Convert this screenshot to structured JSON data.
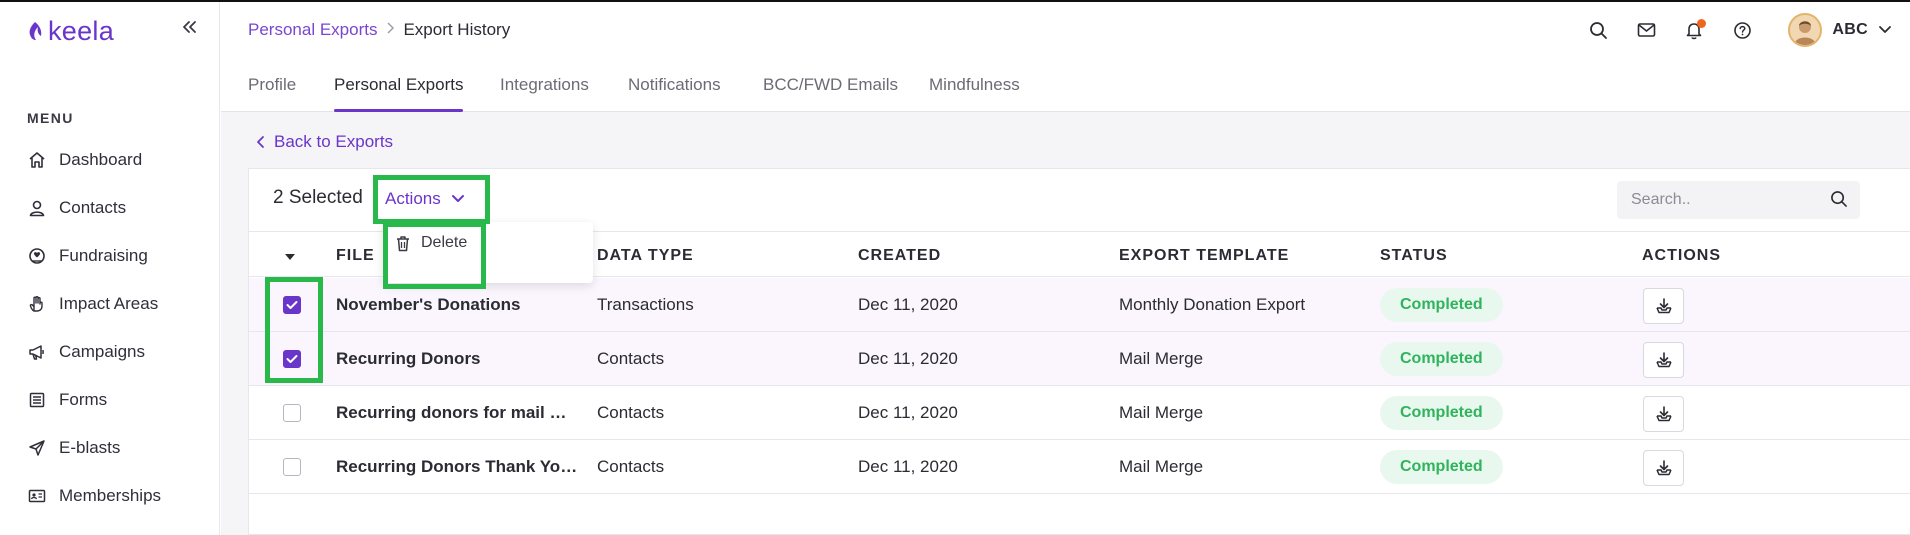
{
  "app": {
    "logo_text": "keela"
  },
  "sidebar": {
    "menu_title": "MENU",
    "items": [
      {
        "label": "Dashboard",
        "icon": "home-icon"
      },
      {
        "label": "Contacts",
        "icon": "user-icon"
      },
      {
        "label": "Fundraising",
        "icon": "donation-icon"
      },
      {
        "label": "Impact Areas",
        "icon": "hand-icon"
      },
      {
        "label": "Campaigns",
        "icon": "megaphone-icon"
      },
      {
        "label": "Forms",
        "icon": "form-icon"
      },
      {
        "label": "E-blasts",
        "icon": "send-icon"
      },
      {
        "label": "Memberships",
        "icon": "id-card-icon"
      }
    ]
  },
  "header": {
    "breadcrumb": {
      "parent": "Personal Exports",
      "current": "Export History"
    },
    "user_name": "ABC"
  },
  "tabs": [
    {
      "label": "Profile",
      "active": false
    },
    {
      "label": "Personal Exports",
      "active": true
    },
    {
      "label": "Integrations",
      "active": false
    },
    {
      "label": "Notifications",
      "active": false
    },
    {
      "label": "BCC/FWD Emails",
      "active": false
    },
    {
      "label": "Mindfulness",
      "active": false
    }
  ],
  "main": {
    "back_label": "Back to Exports",
    "selected_text": "2 Selected",
    "actions_label": "Actions",
    "dropdown": {
      "delete_label": "Delete"
    },
    "search_placeholder": "Search..",
    "columns": [
      "FILE",
      "DATA TYPE",
      "CREATED",
      "EXPORT TEMPLATE",
      "STATUS",
      "ACTIONS"
    ],
    "rows": [
      {
        "file": "November's Donations",
        "data_type": "Transactions",
        "created": "Dec 11, 2020",
        "template": "Monthly Donation Export",
        "status": "Completed",
        "checked": true
      },
      {
        "file": "Recurring Donors",
        "data_type": "Contacts",
        "created": "Dec 11, 2020",
        "template": "Mail Merge",
        "status": "Completed",
        "checked": true
      },
      {
        "file": "Recurring donors for mail merge",
        "data_type": "Contacts",
        "created": "Dec 11, 2020",
        "template": "Mail Merge",
        "status": "Completed",
        "checked": false
      },
      {
        "file": "Recurring Donors Thank You Letter",
        "data_type": "Contacts",
        "created": "Dec 11, 2020",
        "template": "Mail Merge",
        "status": "Completed",
        "checked": false
      }
    ]
  },
  "colors": {
    "brand": "#6a35c9",
    "status_green": "#2fb35c",
    "highlight": "#28b94a",
    "notification": "#f0661f"
  }
}
